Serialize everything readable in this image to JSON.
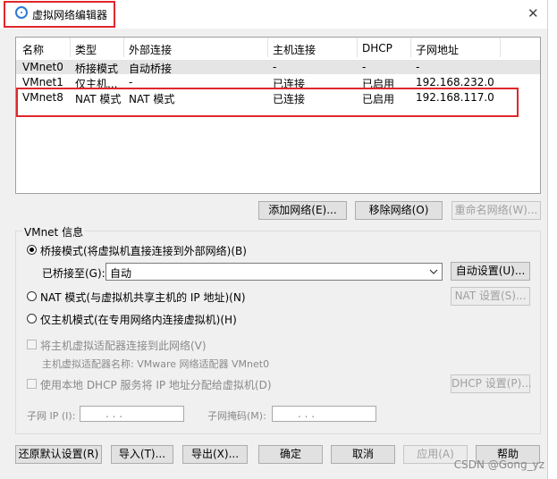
{
  "window": {
    "title": "虚拟网络编辑器",
    "close_glyph": "✕"
  },
  "table": {
    "headers": [
      "名称",
      "类型",
      "外部连接",
      "主机连接",
      "DHCP",
      "子网地址"
    ],
    "rows": [
      [
        "VMnet0",
        "桥接模式",
        "自动桥接",
        "-",
        "-",
        "-"
      ],
      [
        "VMnet1",
        "仅主机...",
        "-",
        "已连接",
        "已启用",
        "192.168.232.0"
      ],
      [
        "VMnet8",
        "NAT 模式",
        "NAT 模式",
        "已连接",
        "已启用",
        "192.168.117.0"
      ]
    ]
  },
  "table_buttons": {
    "add": "添加网络(E)...",
    "remove": "移除网络(O)",
    "rename": "重命名网络(W)..."
  },
  "vmnet_info": {
    "legend": "VMnet 信息",
    "bridged_label": "桥接模式(将虚拟机直接连接到外部网络)(B)",
    "bridged_to_label": "已桥接至(G):",
    "bridged_to_value": "自动",
    "auto_settings": "自动设置(U)...",
    "nat_label": "NAT 模式(与虚拟机共享主机的 IP 地址)(N)",
    "nat_settings": "NAT 设置(S)...",
    "hostonly_label": "仅主机模式(在专用网络内连接虚拟机)(H)",
    "connect_adapter_label": "将主机虚拟适配器连接到此网络(V)",
    "adapter_name_label": "主机虚拟适配器名称: VMware 网络适配器 VMnet0",
    "dhcp_label": "使用本地 DHCP 服务将 IP 地址分配给虚拟机(D)",
    "dhcp_settings": "DHCP 设置(P)...",
    "subnet_ip_label": "子网 IP (I):",
    "subnet_mask_label": "子网掩码(M):",
    "ip_dots": ".       .       ."
  },
  "footer": {
    "restore": "还原默认设置(R)",
    "import": "导入(T)...",
    "export": "导出(X)...",
    "ok": "确定",
    "cancel": "取消",
    "apply": "应用(A)",
    "help": "帮助"
  },
  "watermark": "CSDN @Gong_yz",
  "highlight_color": "#e0272c"
}
